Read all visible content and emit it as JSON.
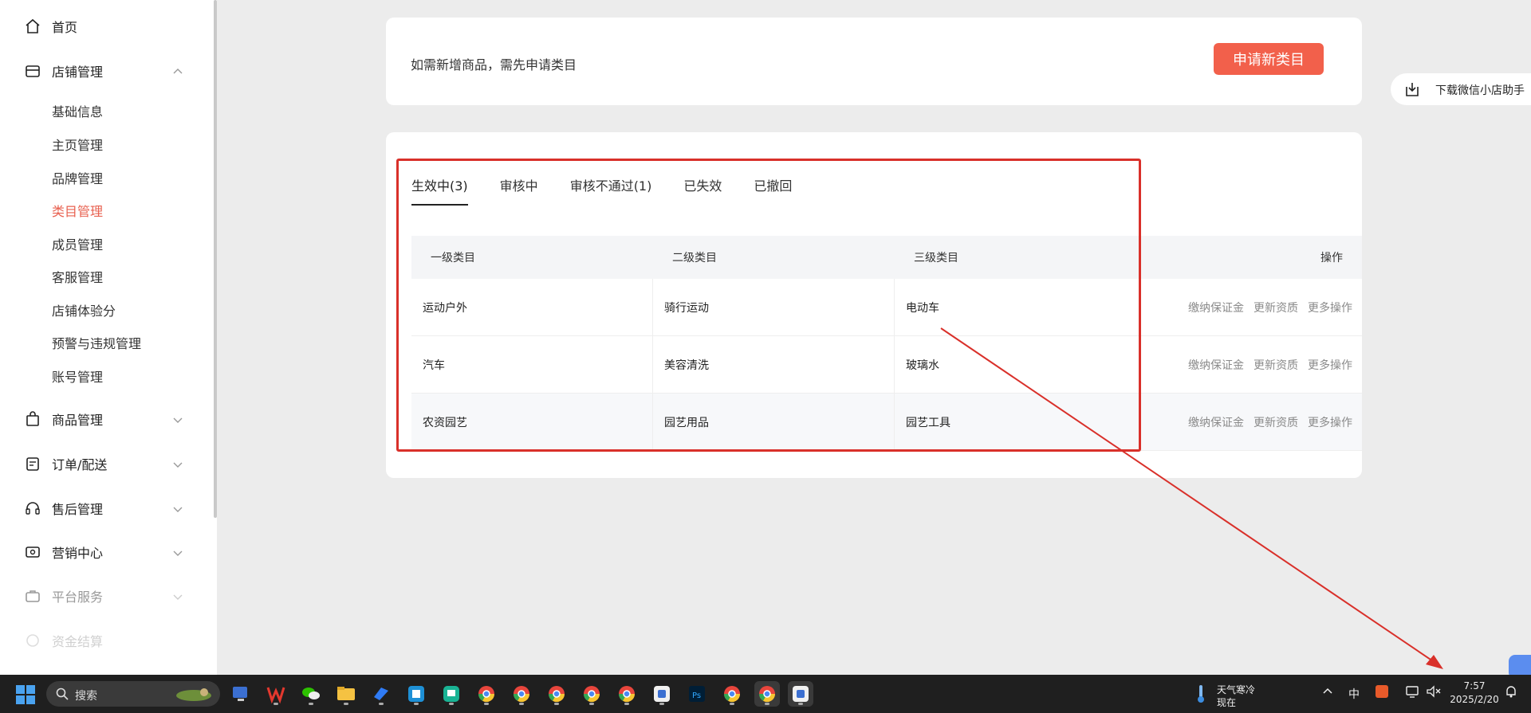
{
  "sidebar": {
    "home": "首页",
    "store": {
      "label": "店铺管理",
      "items": [
        "基础信息",
        "主页管理",
        "品牌管理",
        "类目管理",
        "成员管理",
        "客服管理",
        "店铺体验分",
        "预警与违规管理",
        "账号管理"
      ],
      "active_index": 3
    },
    "product": "商品管理",
    "orders": "订单/配送",
    "aftersale": "售后管理",
    "marketing": "营销中心",
    "platform": "平台服务",
    "settlement": "资金结算"
  },
  "top_card": {
    "hint": "如需新增商品，需先申请类目",
    "apply_button": "申请新类目"
  },
  "tabs": [
    {
      "label": "生效中(3)",
      "active": true
    },
    {
      "label": "审核中",
      "active": false
    },
    {
      "label": "审核不通过(1)",
      "active": false
    },
    {
      "label": "已失效",
      "active": false
    },
    {
      "label": "已撤回",
      "active": false
    }
  ],
  "table": {
    "headers": {
      "level1": "一级类目",
      "level2": "二级类目",
      "level3": "三级类目",
      "ops": "操作"
    },
    "rows": [
      {
        "level1": "运动户外",
        "level2": "骑行运动",
        "level3": "电动车"
      },
      {
        "level1": "汽车",
        "level2": "美容清洗",
        "level3": "玻璃水"
      },
      {
        "level1": "农资园艺",
        "level2": "园艺用品",
        "level3": "园艺工具"
      }
    ],
    "actions": {
      "deposit": "缴纳保证金",
      "update": "更新资质",
      "more": "更多操作"
    }
  },
  "floating": {
    "download": "下载微信小店助手"
  },
  "taskbar": {
    "search": "搜索",
    "weather_line1": "天气寒冷",
    "weather_line2": "现在",
    "ime": "中",
    "time": "7:57",
    "date": "2025/2/20"
  },
  "colors": {
    "accent": "#f2604b",
    "active_nav": "#e8604f",
    "annotation_red": "#d9302a"
  }
}
